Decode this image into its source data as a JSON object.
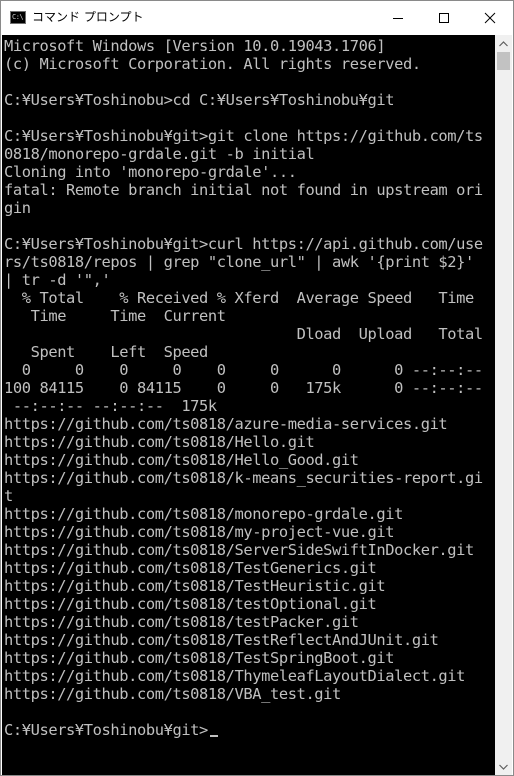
{
  "window": {
    "title": "コマンド プロンプト",
    "icon_label": "C:\\",
    "icons": {
      "app": "cmd-icon",
      "minimize": "minimize-icon",
      "maximize": "maximize-icon",
      "close": "close-icon",
      "scroll_up": "scroll-up-arrow-icon",
      "scroll_down": "scroll-down-arrow-icon"
    }
  },
  "colors": {
    "console_background": "#000000",
    "console_text": "#c0c0c0",
    "titlebar_background": "#ffffff"
  },
  "console": {
    "lines": [
      "Microsoft Windows [Version 10.0.19043.1706]",
      "(c) Microsoft Corporation. All rights reserved.",
      "",
      "C:¥Users¥Toshinobu>cd C:¥Users¥Toshinobu¥git",
      "",
      "C:¥Users¥Toshinobu¥git>git clone https://github.com/ts",
      "0818/monorepo-grdale.git -b initial",
      "Cloning into 'monorepo-grdale'...",
      "fatal: Remote branch initial not found in upstream ori",
      "gin",
      "",
      "C:¥Users¥Toshinobu¥git>curl https://api.github.com/use",
      "rs/ts0818/repos | grep \"clone_url\" | awk '{print $2}'",
      "| tr -d '\",'",
      "  % Total    % Received % Xferd  Average Speed   Time",
      "   Time     Time  Current",
      "                                 Dload  Upload   Total",
      "   Spent    Left  Speed",
      "  0     0    0     0    0     0      0      0 --:--:--",
      "100 84115    0 84115    0     0   175k      0 --:--:--",
      " --:--:-- --:--:--  175k",
      "https://github.com/ts0818/azure-media-services.git",
      "https://github.com/ts0818/Hello.git",
      "https://github.com/ts0818/Hello_Good.git",
      "https://github.com/ts0818/k-means_securities-report.gi",
      "t",
      "https://github.com/ts0818/monorepo-grdale.git",
      "https://github.com/ts0818/my-project-vue.git",
      "https://github.com/ts0818/ServerSideSwiftInDocker.git",
      "https://github.com/ts0818/TestGenerics.git",
      "https://github.com/ts0818/TestHeuristic.git",
      "https://github.com/ts0818/testOptional.git",
      "https://github.com/ts0818/testPacker.git",
      "https://github.com/ts0818/TestReflectAndJUnit.git",
      "https://github.com/ts0818/TestSpringBoot.git",
      "https://github.com/ts0818/ThymeleafLayoutDialect.git",
      "https://github.com/ts0818/VBA_test.git",
      "",
      "C:¥Users¥Toshinobu¥git>"
    ]
  }
}
